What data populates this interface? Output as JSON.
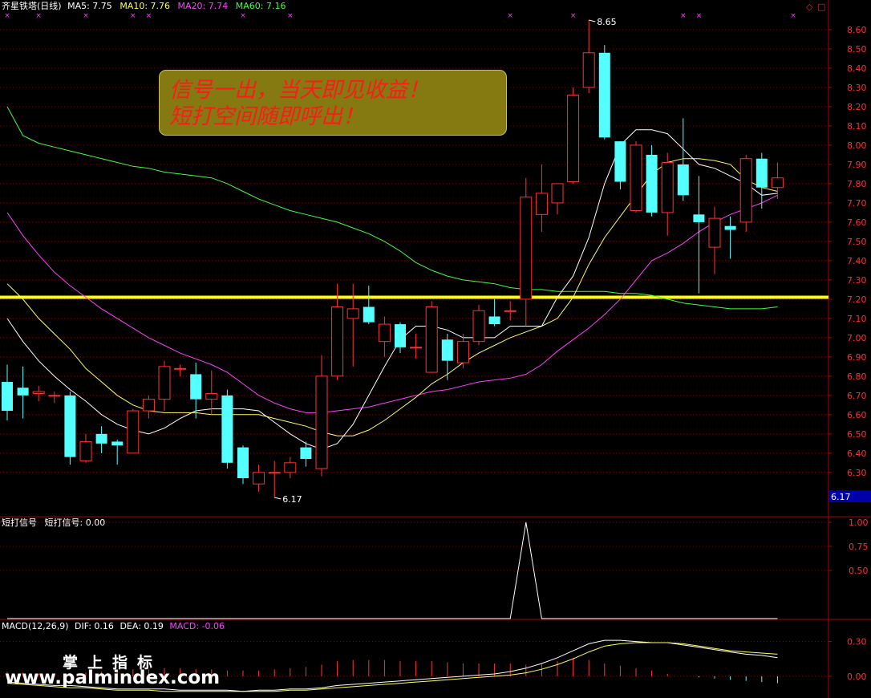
{
  "header": {
    "title": "齐星铁塔(日线)",
    "ma5": "MA5: 7.75",
    "ma10": "MA10: 7.76",
    "ma20": "MA20: 7.74",
    "ma60": "MA60: 7.16"
  },
  "banner": {
    "line1": "信号一出，当天即见收益！",
    "line2": "短打空间随即呼出！"
  },
  "signal_panel": {
    "title": "短打信号",
    "value_label": "短打信号: 0.00"
  },
  "macd_panel": {
    "title": "MACD(12,26,9)",
    "dif": "DIF: 0.16",
    "dea": "DEA: 0.19",
    "macd": "MACD: -0.06"
  },
  "watermark": {
    "line1": "掌上指标",
    "line2": "www.palmindex.com"
  },
  "colors": {
    "up": "#ff3232",
    "down": "#54ffff",
    "ma5": "#ffffff",
    "ma10": "#ffff60",
    "ma20": "#ff40ff",
    "ma60": "#40ff40",
    "support": "#ffff00",
    "axis": "#b00000"
  },
  "chart_data": [
    {
      "type": "candlestick",
      "title": "齐星铁塔(日线)",
      "ylim": [
        6.17,
        8.65
      ],
      "yticks": [
        6.3,
        6.4,
        6.5,
        6.6,
        6.7,
        6.8,
        6.9,
        7.0,
        7.1,
        7.2,
        7.3,
        7.4,
        7.5,
        7.6,
        7.7,
        7.8,
        7.9,
        8.0,
        8.1,
        8.2,
        8.3,
        8.4,
        8.5,
        8.6
      ],
      "current_price_label": "6.17",
      "annotations": [
        {
          "label": "8.65",
          "x": 37,
          "y": 8.65
        },
        {
          "label": "6.17",
          "x": 17,
          "y": 6.17
        }
      ],
      "support_line": 7.21,
      "signal_markers_x": [
        0,
        2,
        5,
        8,
        9,
        15,
        18,
        32,
        36,
        43,
        44,
        50
      ],
      "candles": [
        {
          "o": 6.77,
          "h": 6.86,
          "l": 6.57,
          "c": 6.62
        },
        {
          "o": 6.74,
          "h": 6.85,
          "l": 6.58,
          "c": 6.7
        },
        {
          "o": 6.71,
          "h": 6.75,
          "l": 6.67,
          "c": 6.72
        },
        {
          "o": 6.7,
          "h": 6.72,
          "l": 6.66,
          "c": 6.7
        },
        {
          "o": 6.7,
          "h": 6.72,
          "l": 6.34,
          "c": 6.38
        },
        {
          "o": 6.36,
          "h": 6.5,
          "l": 6.35,
          "c": 6.46
        },
        {
          "o": 6.5,
          "h": 6.54,
          "l": 6.4,
          "c": 6.45
        },
        {
          "o": 6.46,
          "h": 6.47,
          "l": 6.34,
          "c": 6.44
        },
        {
          "o": 6.4,
          "h": 6.63,
          "l": 6.4,
          "c": 6.62
        },
        {
          "o": 6.62,
          "h": 6.7,
          "l": 6.58,
          "c": 6.68
        },
        {
          "o": 6.68,
          "h": 6.88,
          "l": 6.62,
          "c": 6.85
        },
        {
          "o": 6.84,
          "h": 6.86,
          "l": 6.8,
          "c": 6.84
        },
        {
          "o": 6.81,
          "h": 6.87,
          "l": 6.58,
          "c": 6.68
        },
        {
          "o": 6.68,
          "h": 6.83,
          "l": 6.6,
          "c": 6.71
        },
        {
          "o": 6.7,
          "h": 6.73,
          "l": 6.32,
          "c": 6.35
        },
        {
          "o": 6.43,
          "h": 6.44,
          "l": 6.24,
          "c": 6.27
        },
        {
          "o": 6.24,
          "h": 6.34,
          "l": 6.2,
          "c": 6.3
        },
        {
          "o": 6.3,
          "h": 6.36,
          "l": 6.17,
          "c": 6.3
        },
        {
          "o": 6.3,
          "h": 6.38,
          "l": 6.27,
          "c": 6.35
        },
        {
          "o": 6.43,
          "h": 6.46,
          "l": 6.33,
          "c": 6.37
        },
        {
          "o": 6.32,
          "h": 6.91,
          "l": 6.28,
          "c": 6.8
        },
        {
          "o": 6.8,
          "h": 7.28,
          "l": 6.78,
          "c": 7.16
        },
        {
          "o": 7.1,
          "h": 7.28,
          "l": 6.85,
          "c": 7.15
        },
        {
          "o": 7.16,
          "h": 7.27,
          "l": 7.07,
          "c": 7.08
        },
        {
          "o": 6.98,
          "h": 7.11,
          "l": 6.9,
          "c": 7.07
        },
        {
          "o": 7.07,
          "h": 7.08,
          "l": 6.92,
          "c": 6.95
        },
        {
          "o": 6.95,
          "h": 7.02,
          "l": 6.89,
          "c": 6.95
        },
        {
          "o": 6.82,
          "h": 7.19,
          "l": 6.82,
          "c": 7.16
        },
        {
          "o": 6.99,
          "h": 7.02,
          "l": 6.78,
          "c": 6.88
        },
        {
          "o": 6.87,
          "h": 7.02,
          "l": 6.84,
          "c": 6.98
        },
        {
          "o": 6.98,
          "h": 7.17,
          "l": 6.96,
          "c": 7.14
        },
        {
          "o": 7.11,
          "h": 7.2,
          "l": 7.06,
          "c": 7.07
        },
        {
          "o": 7.14,
          "h": 7.19,
          "l": 7.09,
          "c": 7.14
        },
        {
          "o": 7.2,
          "h": 7.83,
          "l": 7.06,
          "c": 7.73
        },
        {
          "o": 7.64,
          "h": 7.9,
          "l": 7.55,
          "c": 7.75
        },
        {
          "o": 7.7,
          "h": 7.8,
          "l": 7.64,
          "c": 7.8
        },
        {
          "o": 7.81,
          "h": 8.3,
          "l": 7.8,
          "c": 8.26
        },
        {
          "o": 8.3,
          "h": 8.65,
          "l": 8.27,
          "c": 8.48
        },
        {
          "o": 8.48,
          "h": 8.52,
          "l": 8.03,
          "c": 8.04
        },
        {
          "o": 8.02,
          "h": 8.02,
          "l": 7.77,
          "c": 7.81
        },
        {
          "o": 7.66,
          "h": 8.02,
          "l": 7.65,
          "c": 8.0
        },
        {
          "o": 7.95,
          "h": 8.0,
          "l": 7.63,
          "c": 7.65
        },
        {
          "o": 7.65,
          "h": 7.96,
          "l": 7.53,
          "c": 7.91
        },
        {
          "o": 7.9,
          "h": 8.14,
          "l": 7.71,
          "c": 7.74
        },
        {
          "o": 7.64,
          "h": 7.84,
          "l": 7.23,
          "c": 7.6
        },
        {
          "o": 7.47,
          "h": 7.68,
          "l": 7.33,
          "c": 7.62
        },
        {
          "o": 7.58,
          "h": 7.63,
          "l": 7.41,
          "c": 7.56
        },
        {
          "o": 7.6,
          "h": 7.95,
          "l": 7.55,
          "c": 7.93
        },
        {
          "o": 7.93,
          "h": 7.96,
          "l": 7.67,
          "c": 7.78
        },
        {
          "o": 7.78,
          "h": 7.91,
          "l": 7.72,
          "c": 7.83
        }
      ],
      "ma5": [
        7.1,
        6.98,
        6.88,
        6.8,
        6.73,
        6.67,
        6.6,
        6.55,
        6.52,
        6.5,
        6.53,
        6.58,
        6.62,
        6.63,
        6.63,
        6.63,
        6.62,
        6.56,
        6.5,
        6.45,
        6.42,
        6.45,
        6.55,
        6.7,
        6.85,
        6.99,
        7.06,
        7.06,
        7.04,
        7.0,
        7.0,
        7.0,
        7.06,
        7.06,
        7.06,
        7.21,
        7.32,
        7.52,
        7.8,
        8.0,
        8.08,
        8.08,
        8.06,
        7.98,
        7.9,
        7.88,
        7.84,
        7.8,
        7.74,
        7.75
      ],
      "ma10": [
        7.28,
        7.2,
        7.1,
        7.02,
        6.94,
        6.84,
        6.77,
        6.7,
        6.65,
        6.62,
        6.61,
        6.61,
        6.61,
        6.6,
        6.6,
        6.6,
        6.6,
        6.58,
        6.56,
        6.54,
        6.51,
        6.49,
        6.49,
        6.52,
        6.57,
        6.63,
        6.69,
        6.76,
        6.81,
        6.87,
        6.92,
        6.96,
        7.0,
        7.03,
        7.06,
        7.1,
        7.21,
        7.38,
        7.52,
        7.63,
        7.74,
        7.85,
        7.91,
        7.93,
        7.93,
        7.92,
        7.9,
        7.82,
        7.78,
        7.76
      ],
      "ma20": [
        7.65,
        7.53,
        7.43,
        7.34,
        7.27,
        7.21,
        7.15,
        7.1,
        7.05,
        7.0,
        6.96,
        6.92,
        6.89,
        6.86,
        6.82,
        6.76,
        6.7,
        6.66,
        6.63,
        6.61,
        6.61,
        6.62,
        6.63,
        6.64,
        6.66,
        6.68,
        6.7,
        6.72,
        6.73,
        6.75,
        6.77,
        6.78,
        6.79,
        6.81,
        6.86,
        6.93,
        6.99,
        7.05,
        7.12,
        7.2,
        7.3,
        7.4,
        7.44,
        7.49,
        7.55,
        7.6,
        7.64,
        7.67,
        7.7,
        7.74
      ],
      "ma60": [
        8.2,
        8.05,
        8.01,
        7.99,
        7.97,
        7.95,
        7.93,
        7.91,
        7.89,
        7.88,
        7.86,
        7.85,
        7.84,
        7.83,
        7.8,
        7.76,
        7.72,
        7.69,
        7.66,
        7.64,
        7.62,
        7.6,
        7.57,
        7.54,
        7.5,
        7.45,
        7.39,
        7.35,
        7.32,
        7.3,
        7.29,
        7.28,
        7.26,
        7.25,
        7.25,
        7.24,
        7.24,
        7.24,
        7.24,
        7.23,
        7.23,
        7.22,
        7.2,
        7.18,
        7.17,
        7.16,
        7.15,
        7.15,
        7.15,
        7.16
      ]
    },
    {
      "type": "line",
      "title": "短打信号",
      "ylim": [
        0,
        1.05
      ],
      "yticks": [
        0.5,
        0.75,
        1.0
      ],
      "values": [
        0,
        0,
        0,
        0,
        0,
        0,
        0,
        0,
        0,
        0,
        0,
        0,
        0,
        0,
        0,
        0,
        0,
        0,
        0,
        0,
        0,
        0,
        0,
        0,
        0,
        0,
        0,
        0,
        0,
        0,
        0,
        0,
        0,
        1,
        0,
        0,
        0,
        0,
        0,
        0,
        0,
        0,
        0,
        0,
        0,
        0,
        0,
        0,
        0,
        0
      ]
    },
    {
      "type": "bar",
      "title": "MACD(12,26,9)",
      "ylim": [
        -0.16,
        0.38
      ],
      "yticks": [
        0.0,
        0.3
      ],
      "macd_bars": [
        0.04,
        0.03,
        0.02,
        0.02,
        0.02,
        0.03,
        0.04,
        0.05,
        0.06,
        0.06,
        0.07,
        0.07,
        0.06,
        0.06,
        0.05,
        0.05,
        0.05,
        0.06,
        0.07,
        0.08,
        0.1,
        0.13,
        0.14,
        0.14,
        0.14,
        0.13,
        0.13,
        0.13,
        0.12,
        0.11,
        0.11,
        0.11,
        0.11,
        0.1,
        0.11,
        0.13,
        0.16,
        0.14,
        0.11,
        0.09,
        0.07,
        0.05,
        0.02,
        0.0,
        -0.01,
        -0.02,
        -0.03,
        -0.04,
        -0.05,
        -0.06
      ],
      "dif": [
        -0.05,
        -0.06,
        -0.07,
        -0.08,
        -0.08,
        -0.09,
        -0.1,
        -0.11,
        -0.11,
        -0.11,
        -0.11,
        -0.12,
        -0.12,
        -0.12,
        -0.12,
        -0.13,
        -0.12,
        -0.12,
        -0.11,
        -0.11,
        -0.1,
        -0.08,
        -0.07,
        -0.06,
        -0.05,
        -0.04,
        -0.03,
        -0.02,
        -0.01,
        0.0,
        0.01,
        0.02,
        0.04,
        0.07,
        0.11,
        0.16,
        0.22,
        0.28,
        0.31,
        0.31,
        0.3,
        0.29,
        0.29,
        0.27,
        0.25,
        0.23,
        0.21,
        0.19,
        0.18,
        0.16
      ],
      "dea": [
        -0.06,
        -0.07,
        -0.08,
        -0.09,
        -0.1,
        -0.1,
        -0.11,
        -0.12,
        -0.12,
        -0.12,
        -0.13,
        -0.13,
        -0.13,
        -0.13,
        -0.13,
        -0.13,
        -0.13,
        -0.13,
        -0.12,
        -0.12,
        -0.11,
        -0.1,
        -0.09,
        -0.08,
        -0.07,
        -0.06,
        -0.05,
        -0.04,
        -0.03,
        -0.02,
        -0.01,
        0.0,
        0.01,
        0.03,
        0.06,
        0.1,
        0.15,
        0.21,
        0.26,
        0.28,
        0.29,
        0.29,
        0.29,
        0.28,
        0.26,
        0.24,
        0.22,
        0.21,
        0.2,
        0.19
      ]
    }
  ]
}
